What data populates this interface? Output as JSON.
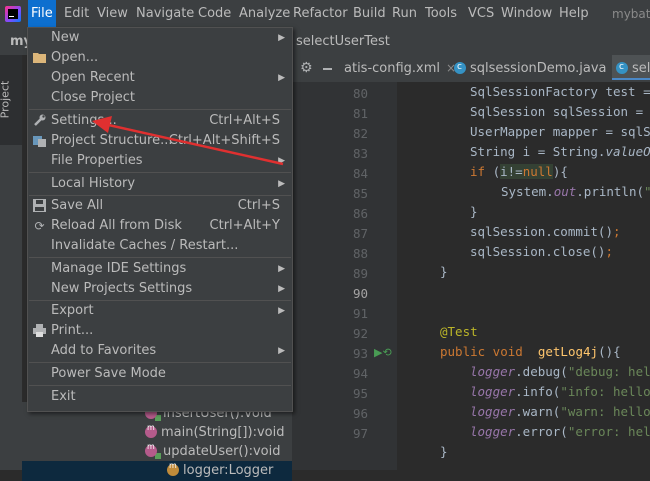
{
  "menubar": {
    "items": [
      "File",
      "Edit",
      "View",
      "Navigate",
      "Code",
      "Analyze",
      "Refactor",
      "Build",
      "Run",
      "Tools",
      "VCS",
      "Window",
      "Help"
    ],
    "title": "mybati"
  },
  "navbar": {
    "project": "my",
    "breadcrumb": "selectUserTest"
  },
  "sidebar": {
    "tab": "Project"
  },
  "tabs": [
    {
      "label": "atis-config.xml"
    },
    {
      "label": "sqlsessionDemo.java"
    },
    {
      "label": "sel"
    }
  ],
  "file_menu": [
    {
      "label": "New",
      "shortcut": "",
      "submenu": true,
      "icon": ""
    },
    {
      "label": "Open...",
      "shortcut": "",
      "submenu": false,
      "icon": "folder-icon"
    },
    {
      "label": "Open Recent",
      "shortcut": "",
      "submenu": true,
      "icon": ""
    },
    {
      "label": "Close Project",
      "shortcut": "",
      "submenu": false,
      "icon": ""
    },
    {
      "label": "Settings...",
      "shortcut": "Ctrl+Alt+S",
      "submenu": false,
      "icon": "wrench-icon"
    },
    {
      "label": "Project Structure...",
      "shortcut": "Ctrl+Alt+Shift+S",
      "submenu": false,
      "icon": "project-structure-icon"
    },
    {
      "label": "File Properties",
      "shortcut": "",
      "submenu": true,
      "icon": ""
    },
    {
      "label": "Local History",
      "shortcut": "",
      "submenu": true,
      "icon": ""
    },
    {
      "label": "Save All",
      "shortcut": "Ctrl+S",
      "submenu": false,
      "icon": "save-icon"
    },
    {
      "label": "Reload All from Disk",
      "shortcut": "Ctrl+Alt+Y",
      "submenu": false,
      "icon": "reload-icon"
    },
    {
      "label": "Invalidate Caches / Restart...",
      "shortcut": "",
      "submenu": false,
      "icon": ""
    },
    {
      "label": "Manage IDE Settings",
      "shortcut": "",
      "submenu": true,
      "icon": ""
    },
    {
      "label": "New Projects Settings",
      "shortcut": "",
      "submenu": true,
      "icon": ""
    },
    {
      "label": "Export",
      "shortcut": "",
      "submenu": true,
      "icon": ""
    },
    {
      "label": "Print...",
      "shortcut": "",
      "submenu": false,
      "icon": "print-icon"
    },
    {
      "label": "Add to Favorites",
      "shortcut": "",
      "submenu": true,
      "icon": ""
    },
    {
      "label": "Power Save Mode",
      "shortcut": "",
      "submenu": false,
      "icon": ""
    },
    {
      "label": "Exit",
      "shortcut": "",
      "submenu": false,
      "icon": ""
    }
  ],
  "editor": {
    "line_numbers": [
      "80",
      "81",
      "82",
      "83",
      "84",
      "85",
      "86",
      "87",
      "88",
      "89",
      "90",
      "91",
      "92",
      "93",
      "94",
      "95",
      "96",
      "97"
    ],
    "current_line": "90"
  },
  "project_tree": [
    {
      "label": "insertUser():void"
    },
    {
      "label": "main(String[]):void"
    },
    {
      "label": "updateUser():void"
    },
    {
      "label": "logger:Logger"
    }
  ],
  "colors": {
    "accent": "#0d6fcf",
    "annotation_arrow": "#e03030"
  }
}
